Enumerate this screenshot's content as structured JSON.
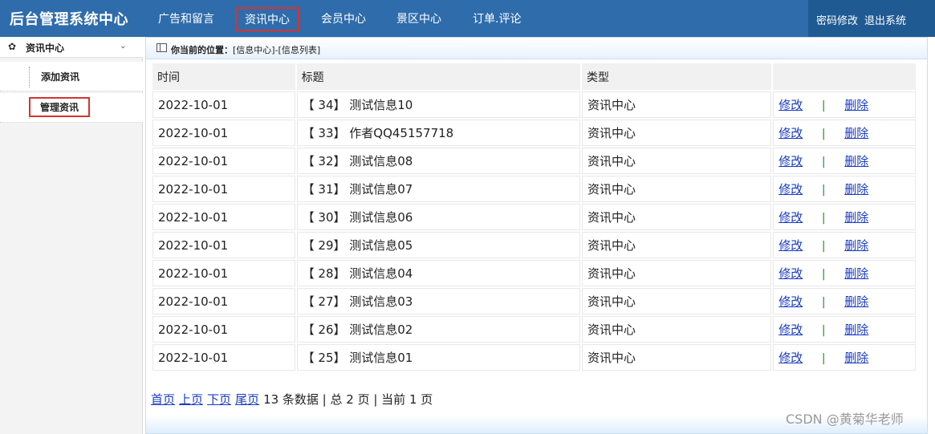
{
  "brand": "后台管理系统中心",
  "nav": [
    {
      "label": "广告和留言"
    },
    {
      "label": "资讯中心"
    },
    {
      "label": "会员中心"
    },
    {
      "label": "景区中心"
    },
    {
      "label": "订单.评论"
    }
  ],
  "top_right": {
    "change_password": "密码修改",
    "logout": "退出系统"
  },
  "sidebar": {
    "header": "资讯中心",
    "items": [
      {
        "label": "添加资讯"
      },
      {
        "label": "管理资讯"
      }
    ]
  },
  "breadcrumb": {
    "prefix": "你当前的位置：",
    "path": "[信息中心]-[信息列表]"
  },
  "table": {
    "headers": [
      "时间",
      "标题",
      "类型",
      ""
    ],
    "edit_label": "修改",
    "separator": "|",
    "delete_label": "删除",
    "rows": [
      {
        "date": "2022-10-01",
        "title": "【 34】 测试信息10",
        "type": "资讯中心"
      },
      {
        "date": "2022-10-01",
        "title": "【 33】 作者QQ45157718",
        "type": "资讯中心"
      },
      {
        "date": "2022-10-01",
        "title": "【 32】 测试信息08",
        "type": "资讯中心"
      },
      {
        "date": "2022-10-01",
        "title": "【 31】 测试信息07",
        "type": "资讯中心"
      },
      {
        "date": "2022-10-01",
        "title": "【 30】 测试信息06",
        "type": "资讯中心"
      },
      {
        "date": "2022-10-01",
        "title": "【 29】 测试信息05",
        "type": "资讯中心"
      },
      {
        "date": "2022-10-01",
        "title": "【 28】 测试信息04",
        "type": "资讯中心"
      },
      {
        "date": "2022-10-01",
        "title": "【 27】 测试信息03",
        "type": "资讯中心"
      },
      {
        "date": "2022-10-01",
        "title": "【 26】 测试信息02",
        "type": "资讯中心"
      },
      {
        "date": "2022-10-01",
        "title": "【 25】 测试信息01",
        "type": "资讯中心"
      }
    ]
  },
  "pager": {
    "first": "首页",
    "prev": "上页",
    "next": "下页",
    "last": "尾页",
    "summary": "13 条数据 | 总 2 页 | 当前 1 页"
  },
  "watermark": "CSDN @黄菊华老师",
  "colors": {
    "topbar": "#2f6cab",
    "highlight": "#d9322e",
    "link": "#1a3cc4"
  }
}
